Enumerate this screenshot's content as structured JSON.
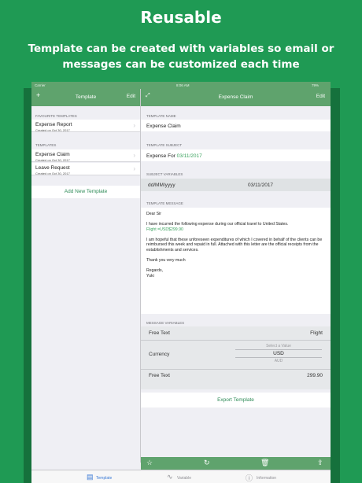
{
  "hero": {
    "title": "Reusable",
    "subtitle": "Template can be created with variables so email or messages can be customized each time"
  },
  "status_bar": {
    "carrier": "Carrier",
    "time": "8:06 AM",
    "battery": "79%"
  },
  "left_nav": {
    "add_icon": "plus-icon",
    "title": "Template",
    "edit_label": "Edit"
  },
  "sidebar": {
    "favourites_header": "FAVOURITE TEMPLATES",
    "favourites": [
      {
        "name": "Expense Report",
        "date": "Created on Oct 30, 2017"
      }
    ],
    "templates_header": "TEMPLATES",
    "templates": [
      {
        "name": "Expense Claim",
        "date": "Created on Oct 30, 2017"
      },
      {
        "name": "Leave Request",
        "date": "Created on Oct 30, 2017"
      }
    ],
    "add_button": "Add New Template"
  },
  "right_nav": {
    "expand_icon": "expand-icon",
    "title": "Expense Claim",
    "edit_label": "Edit"
  },
  "detail": {
    "name_header": "TEMPLATE NAME",
    "name_value": "Expense Claim",
    "subject_header": "TEMPLATE SUBJECT",
    "subject_prefix": "Expense For ",
    "subject_variable": "03/11/2017",
    "subject_vars_header": "SUBJECT VARIABLES",
    "subject_var_format": "dd/MM/yyyy",
    "subject_var_value": "03/11/2017",
    "message_header": "TEMPLATE MESSAGE",
    "message": {
      "greeting": "Dear Sir",
      "line1": "I have incurred the following expense during our official travel to United States.",
      "flight": "Flight ",
      "flight_var": "=USD$299.90",
      "para2": "I am hopeful that these unforeseen expenditures of which I covered in behalf of the clients can be reimbursed this week and repaid in full. Attached with this letter are the official receipts from the establishments and services.",
      "thanks": "Thank you very much",
      "regards": "Regards,",
      "name": "Yuki"
    },
    "msg_vars_header": "MESSAGE VARIABLES",
    "msg_vars": {
      "row1_label": "Free Text",
      "row1_value": "Flight",
      "currency_label": "Currency",
      "picker_placeholder": "Select a Value",
      "picker_selected": "USD",
      "picker_next": "AUD",
      "row3_label": "Free Text",
      "row3_value": "299.90"
    },
    "export_button": "Export Template"
  },
  "toolbar": {
    "icons": [
      "star-icon",
      "refresh-icon",
      "trash-icon",
      "share-icon"
    ]
  },
  "tabbar": {
    "tabs": [
      {
        "label": "Template",
        "icon": "document-icon",
        "active": true
      },
      {
        "label": "Variable",
        "icon": "variable-icon",
        "active": false
      },
      {
        "label": "Information",
        "icon": "info-icon",
        "active": false
      }
    ]
  },
  "colors": {
    "background": "#1f9a54",
    "navbar": "#5fa36d",
    "accent": "#2e8b57",
    "active_tab": "#3b7bd6"
  }
}
